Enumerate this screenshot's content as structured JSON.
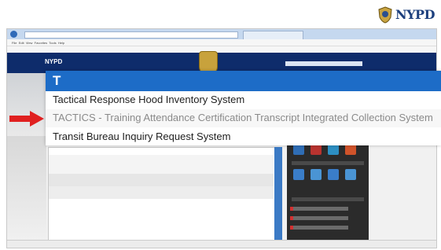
{
  "logo": {
    "word": "NYPD",
    "icon": "nypd-shield-icon"
  },
  "browser": {
    "menu_items": [
      "File",
      "Edit",
      "View",
      "Favorites",
      "Tools",
      "Help"
    ],
    "site_brand": "NYPD"
  },
  "autocomplete": {
    "header_letter": "T",
    "items": [
      "Tactical Response Hood Inventory System",
      "TACTICS - Training Attendance Certification Transcript Integrated Collection System",
      "Transit Bureau Inquiry Request System"
    ],
    "highlighted_index": 1,
    "accent_color": "#1d6cc7",
    "arrow_color": "#e02020"
  }
}
